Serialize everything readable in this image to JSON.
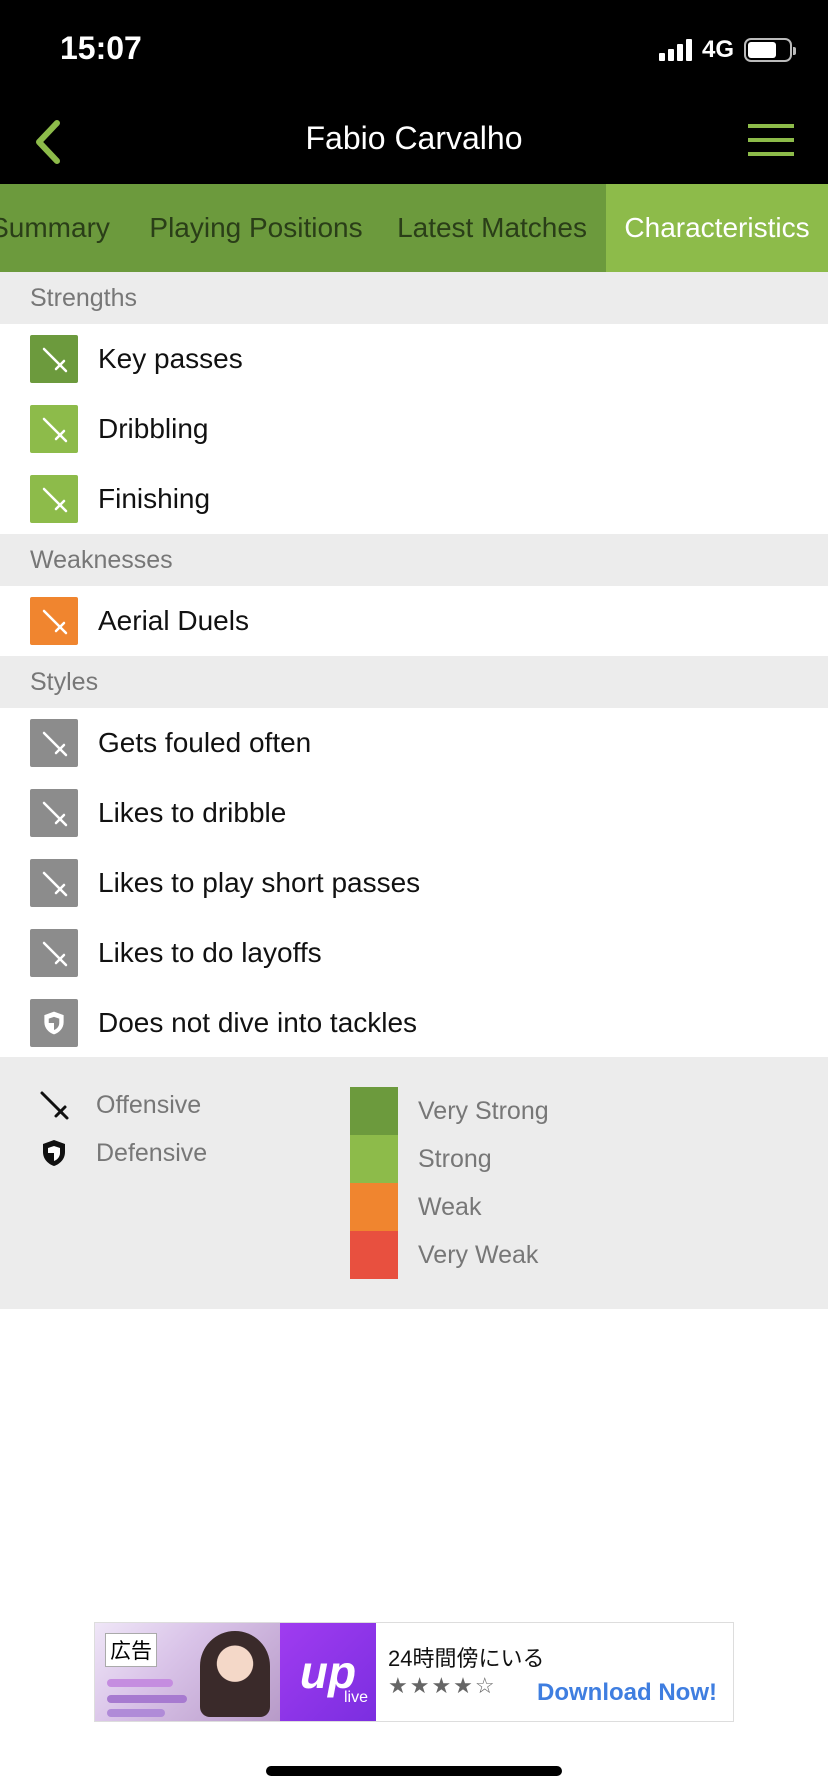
{
  "status_bar": {
    "time": "15:07",
    "network": "4G"
  },
  "nav": {
    "title": "Fabio Carvalho",
    "back_icon": "chevron-left-icon",
    "menu_icon": "hamburger-icon",
    "accent_color": "#8dbb4a"
  },
  "tabs": [
    {
      "label": "Summary",
      "active": false
    },
    {
      "label": "Playing Positions",
      "active": false
    },
    {
      "label": "Latest Matches",
      "active": false
    },
    {
      "label": "Characteristics",
      "active": true
    }
  ],
  "sections": {
    "strengths": {
      "title": "Strengths",
      "items": [
        {
          "label": "Key passes",
          "type": "offensive",
          "level": "very-strong"
        },
        {
          "label": "Dribbling",
          "type": "offensive",
          "level": "strong"
        },
        {
          "label": "Finishing",
          "type": "offensive",
          "level": "strong"
        }
      ]
    },
    "weaknesses": {
      "title": "Weaknesses",
      "items": [
        {
          "label": "Aerial Duels",
          "type": "offensive",
          "level": "weak"
        }
      ]
    },
    "styles": {
      "title": "Styles",
      "items": [
        {
          "label": "Gets fouled often",
          "type": "offensive",
          "level": "neutral"
        },
        {
          "label": "Likes to dribble",
          "type": "offensive",
          "level": "neutral"
        },
        {
          "label": "Likes to play short passes",
          "type": "offensive",
          "level": "neutral"
        },
        {
          "label": "Likes to do layoffs",
          "type": "offensive",
          "level": "neutral"
        },
        {
          "label": "Does not dive into tackles",
          "type": "defensive",
          "level": "neutral"
        }
      ]
    }
  },
  "legend": {
    "types": [
      {
        "label": "Offensive",
        "icon": "sword-icon"
      },
      {
        "label": "Defensive",
        "icon": "shield-icon"
      }
    ],
    "scale": [
      {
        "label": "Very Strong",
        "color": "#6c9a3d"
      },
      {
        "label": "Strong",
        "color": "#8dbb4a"
      },
      {
        "label": "Weak",
        "color": "#f0852f"
      },
      {
        "label": "Very Weak",
        "color": "#e8503f"
      }
    ]
  },
  "colors": {
    "very-strong": "#6c9a3d",
    "strong": "#8dbb4a",
    "weak": "#f0852f",
    "very-weak": "#e8503f",
    "neutral": "#8c8c8c"
  },
  "ad": {
    "tag": "広告",
    "logo_text": "up",
    "logo_sub": "live",
    "title": "24時間傍にいる",
    "stars": "★★★★☆",
    "cta": "Download Now!"
  }
}
